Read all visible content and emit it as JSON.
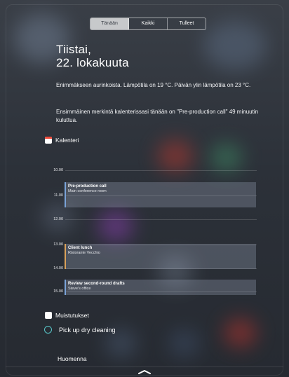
{
  "tabs": [
    {
      "label": "Tänään",
      "active": true
    },
    {
      "label": "Kaikki",
      "active": false
    },
    {
      "label": "Tulleet",
      "active": false
    }
  ],
  "header": {
    "date_line1": "Tiistai,",
    "date_line2": "22. lokakuuta"
  },
  "summary": {
    "weather": "Enimmäkseen aurinkoista. Lämpötila on 19 °C. Päivän ylin lämpötila on 23 °C.",
    "calendar": "Ensimmäinen merkintä kalenterissasi tänään on \"Pre-production call\" 49 minuutin kuluttua."
  },
  "calendar": {
    "title": "Kalenteri",
    "hours": [
      "10.00",
      "11.00",
      "12.00",
      "13.00",
      "14.00",
      "15.00"
    ],
    "events": [
      {
        "title": "Pre-production call",
        "location": "Main conference room"
      },
      {
        "title": "Client lunch",
        "location": "Ristorante Vecchio"
      },
      {
        "title": "Review second-round drafts",
        "location": "Steve's office"
      }
    ]
  },
  "reminders": {
    "title": "Muistutukset",
    "items": [
      {
        "text": "Pick up dry cleaning"
      }
    ]
  },
  "tomorrow": {
    "label": "Huomenna"
  },
  "colors": {
    "accent_calendar": "#f04a3a",
    "reminder_circle": "#58c6c8",
    "event_bar": "#7aa3d8"
  }
}
